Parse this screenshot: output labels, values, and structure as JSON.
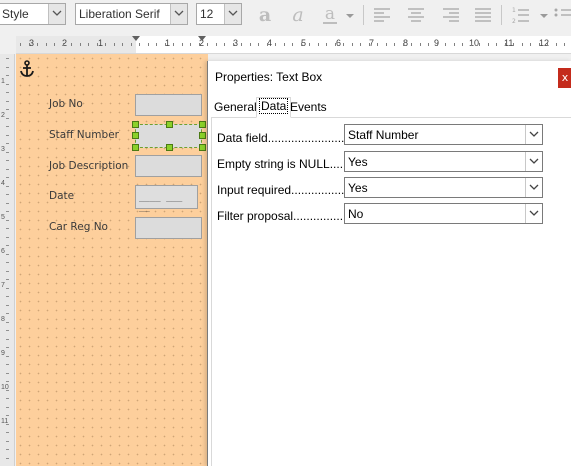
{
  "toolbar": {
    "style_combo": {
      "value": "Style"
    },
    "font_combo": {
      "value": "Liberation Serif"
    },
    "size_combo": {
      "value": "12"
    },
    "icons": [
      "bold-a-icon",
      "italic-a-icon",
      "underline-a-icon",
      "dropdown-arrow-icon",
      "align-left-icon",
      "align-center-icon",
      "align-right-icon",
      "justify-icon",
      "numbered-list-icon",
      "dropdown-arrow-icon",
      "bulleted-list-icon"
    ]
  },
  "ruler": {
    "labels": [
      "3",
      "2",
      "1",
      "1",
      "2",
      "3",
      "4",
      "5",
      "6",
      "7",
      "8",
      "9",
      "10",
      "11",
      "12"
    ]
  },
  "vruler": {
    "labels": [
      "1",
      "2",
      "3",
      "4",
      "5",
      "6",
      "7",
      "8",
      "9",
      "10",
      "11"
    ]
  },
  "form": {
    "fields": [
      {
        "label": "Job No"
      },
      {
        "label": "Staff Number"
      },
      {
        "label": "Job Description"
      },
      {
        "label": "Date",
        "value": "____ ___ __"
      },
      {
        "label": "Car Reg No"
      }
    ]
  },
  "dialog": {
    "title": "Properties: Text Box",
    "close_label": "x",
    "tabs": [
      "General",
      "Data",
      "Events"
    ],
    "active_tab": "Data",
    "properties": [
      {
        "label": "Data field...........................",
        "value": "Staff Number"
      },
      {
        "label": "Empty string is NULL......",
        "value": "Yes"
      },
      {
        "label": "Input required................",
        "value": "Yes"
      },
      {
        "label": "Filter proposal.................",
        "value": "No"
      }
    ]
  },
  "colors": {
    "canvas": "#fdcf9c",
    "selection_handle": "#8bd12a",
    "close_button": "#c42b1c"
  }
}
